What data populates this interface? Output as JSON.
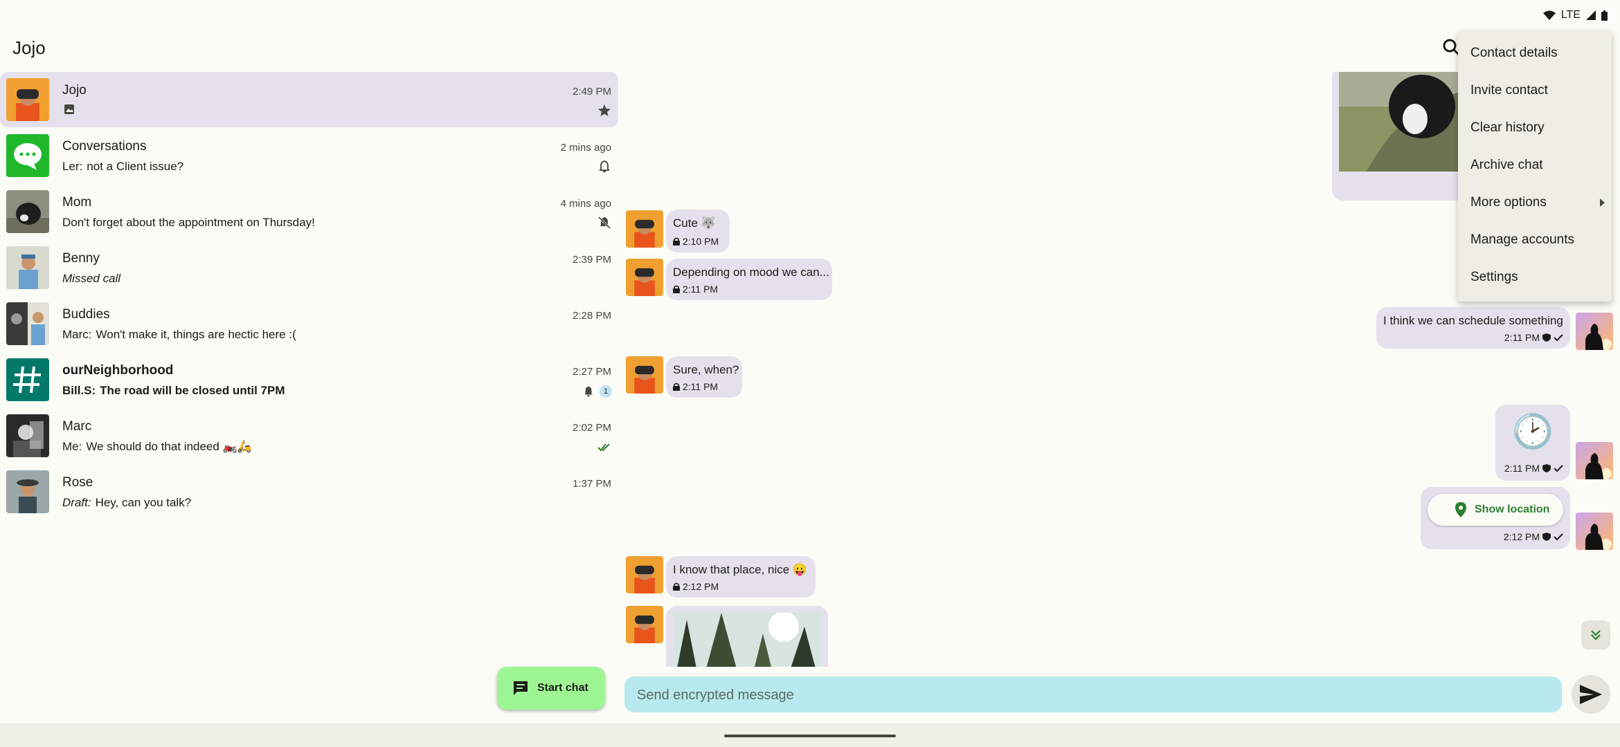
{
  "status_bar": {
    "network": "LTE"
  },
  "app_bar": {
    "title": "Jojo"
  },
  "conversations": [
    {
      "name": "Jojo",
      "time": "2:49 PM",
      "preview_sender": "",
      "preview": "",
      "indicator": "star-icon",
      "preview_icon": "image-icon"
    },
    {
      "name": "Conversations",
      "time": "2 mins ago",
      "preview_sender": "Ler:",
      "preview": "not a Client issue?",
      "indicator": "bell-icon"
    },
    {
      "name": "Mom",
      "time": "4 mins ago",
      "preview_sender": "",
      "preview": "Don't forget about the appointment on Thursday!",
      "indicator": "bell-off-icon"
    },
    {
      "name": "Benny",
      "time": "2:39 PM",
      "preview_sender": "",
      "preview": "Missed call",
      "indicator": ""
    },
    {
      "name": "Buddies",
      "time": "2:28 PM",
      "preview_sender": "Marc:",
      "preview": "Won't make it, things are hectic here :(",
      "indicator": ""
    },
    {
      "name": "ourNeighborhood",
      "time": "2:27 PM",
      "preview_sender": "Bill.S:",
      "preview": "The road will be closed until 7PM",
      "indicator": "bell-icon",
      "unread": "1"
    },
    {
      "name": "Marc",
      "time": "2:02 PM",
      "preview_sender": "Me:",
      "preview": "We should do that indeed 🏍️🛵",
      "indicator": "double-check-icon"
    },
    {
      "name": "Rose",
      "time": "1:37 PM",
      "preview_sender": "Draft:",
      "preview": "Hey, can you talk?",
      "indicator": ""
    }
  ],
  "messages": [
    {
      "text": "Cute 🐺",
      "time": "2:10 PM"
    },
    {
      "text": "Depending on mood we can...",
      "time": "2:11 PM"
    },
    {
      "text": "I think we can schedule something",
      "time": "2:11 PM"
    },
    {
      "text": "Sure, when?",
      "time": "2:11 PM"
    },
    {
      "text": "🕑",
      "time": "2:11 PM"
    },
    {
      "text": "Show location",
      "time": "2:12 PM"
    },
    {
      "text": "I know that place, nice 😛",
      "time": "2:12 PM"
    }
  ],
  "composer": {
    "placeholder": "Send encrypted message"
  },
  "fab": {
    "label": "Start chat"
  },
  "menu": {
    "items": [
      "Contact details",
      "Invite contact",
      "Clear history",
      "Archive chat",
      "More options",
      "Manage accounts",
      "Settings"
    ]
  },
  "colors": {
    "background": "#fbfcf5",
    "selected_row": "#e5e1ec",
    "bubble": "#e5e1ec",
    "composer": "#b8e9ee",
    "fab": "#9ef594",
    "conversations_green": "#1fb82b",
    "channel_teal": "#00796b",
    "check_green": "#2e7d32"
  }
}
